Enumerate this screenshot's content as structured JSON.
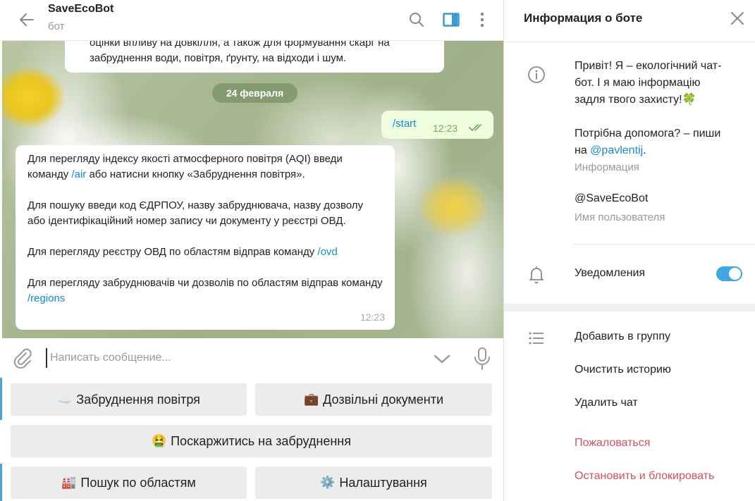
{
  "chat": {
    "title": "SaveEcoBot",
    "subtitle": "бот",
    "prev_message": {
      "line1": "оцінки впливу на довкілля, а також для формування скарг на",
      "line2": "забруднення води, повітря, ґрунту, на відходи і шум."
    },
    "date_pill": "24 февраля",
    "outgoing": {
      "text": "/start",
      "time": "12:23"
    },
    "bot_message": {
      "p1_pre": "Для перегляду індексу якості атмосферного повітря (AQI) введи команду ",
      "p1_cmd": "/air",
      "p1_post": " або натисни кнопку «Забруднення повітря».",
      "p2": "Для пошуку введи код ЄДРПОУ, назву забруднювача, назву дозволу або ідентифікаційний номер запису чи документу у реєстрі ОВД.",
      "p3_pre": "Для перегляду реєстру ОВД по областям відправ команду ",
      "p3_cmd": "/ovd",
      "p4_pre": "Для перегляду забруднювачів чи дозволів по областям відправ команду ",
      "p4_cmd": "/regions",
      "time": "12:23"
    },
    "input_placeholder": "Написать сообщение...",
    "keyboard": {
      "air": {
        "emoji": "☁️",
        "label": "Забруднення повітря"
      },
      "docs": {
        "emoji": "💼",
        "label": "Дозвільні документи"
      },
      "complain": {
        "emoji": "🤮",
        "label": "Поскаржитись на забруднення"
      },
      "regions": {
        "emoji": "🏭",
        "label": "Пошук по областям"
      },
      "settings": {
        "emoji": "⚙️",
        "label": "Налаштування"
      }
    }
  },
  "info": {
    "title": "Информация о боте",
    "description": {
      "line1": "Привіт! Я – екологічний чат-",
      "line2": "бот. І я маю інформацію",
      "line3_pre": "задля твого захисту!",
      "line3_emoji": "🍀",
      "line4": "Потрібна допомога? – пиши",
      "line5_pre": "на ",
      "line5_link": "@pavlentij",
      "line5_post": "."
    },
    "description_caption": "Информация",
    "username": "@SaveEcoBot",
    "username_caption": "Имя пользователя",
    "notifications_label": "Уведомления",
    "notifications_on": true,
    "actions": {
      "add_to_group": "Добавить в группу",
      "clear_history": "Очистить историю",
      "delete_chat": "Удалить чат",
      "report": "Пожаловаться",
      "stop_block": "Остановить и блокировать"
    }
  },
  "colors": {
    "accent": "#40a7e3",
    "link": "#168acd",
    "danger": "#d4505b",
    "outgoing_bubble": "#effdde"
  },
  "icons": [
    "back-arrow-icon",
    "search-icon",
    "sidebar-toggle-icon",
    "more-vertical-icon",
    "paperclip-icon",
    "chevron-down-icon",
    "microphone-icon",
    "close-icon",
    "info-icon",
    "bell-icon",
    "list-icon",
    "double-check-icon"
  ]
}
